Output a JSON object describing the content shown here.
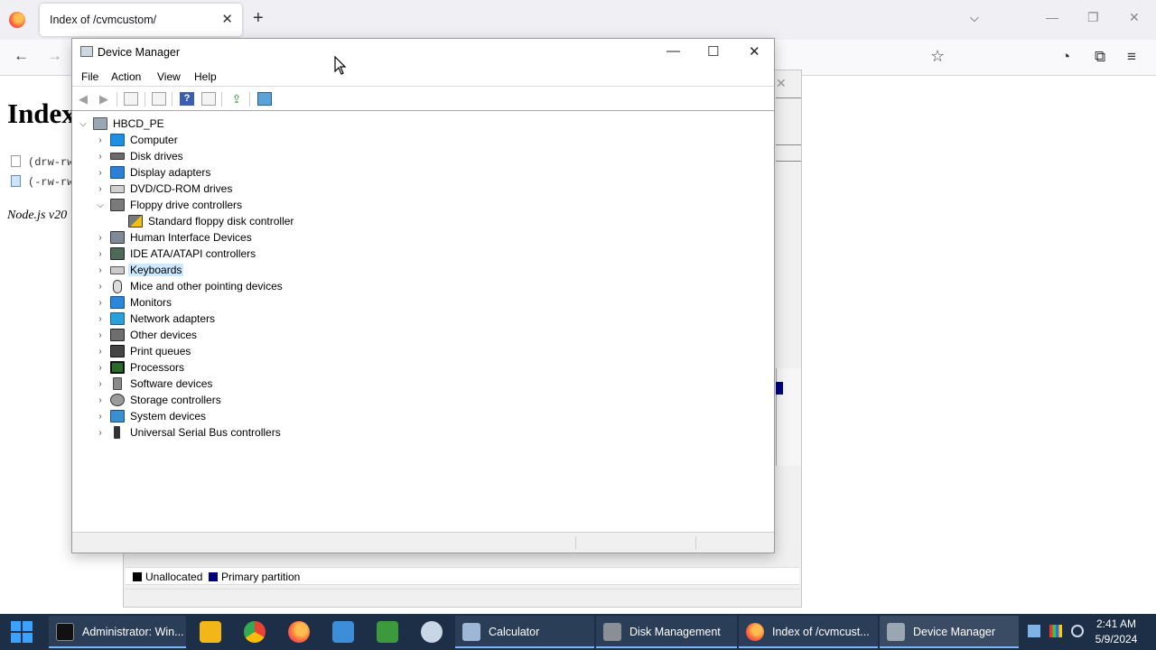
{
  "browser": {
    "tab_title": "Index of /cvmcustom/",
    "page_heading": "Index",
    "files": [
      "(drw-rw",
      "(-rw-rw"
    ],
    "footer": "Node.js v20"
  },
  "disk_management": {
    "legend": {
      "unallocated": "Unallocated",
      "primary": "Primary partition",
      "colors": {
        "unallocated": "#000000",
        "primary": "#000080"
      }
    }
  },
  "device_manager": {
    "title": "Device Manager",
    "menu": [
      "File",
      "Action",
      "View",
      "Help"
    ],
    "root": "HBCD_PE",
    "categories": [
      {
        "label": "Computer",
        "icon": "computer-icon"
      },
      {
        "label": "Disk drives",
        "icon": "disk-drive-icon"
      },
      {
        "label": "Display adapters",
        "icon": "display-adapter-icon"
      },
      {
        "label": "DVD/CD-ROM drives",
        "icon": "dvd-drive-icon"
      },
      {
        "label": "Floppy drive controllers",
        "icon": "floppy-controller-icon",
        "expanded": true,
        "children": [
          {
            "label": "Standard floppy disk controller",
            "icon": "floppy-warning-icon"
          }
        ]
      },
      {
        "label": "Human Interface Devices",
        "icon": "hid-icon"
      },
      {
        "label": "IDE ATA/ATAPI controllers",
        "icon": "ide-controller-icon"
      },
      {
        "label": "Keyboards",
        "icon": "keyboard-icon",
        "selected": true
      },
      {
        "label": "Mice and other pointing devices",
        "icon": "mouse-icon"
      },
      {
        "label": "Monitors",
        "icon": "monitor-icon"
      },
      {
        "label": "Network adapters",
        "icon": "network-adapter-icon"
      },
      {
        "label": "Other devices",
        "icon": "other-devices-icon"
      },
      {
        "label": "Print queues",
        "icon": "printer-icon"
      },
      {
        "label": "Processors",
        "icon": "processor-icon"
      },
      {
        "label": "Software devices",
        "icon": "software-device-icon"
      },
      {
        "label": "Storage controllers",
        "icon": "storage-controller-icon"
      },
      {
        "label": "System devices",
        "icon": "system-devices-icon"
      },
      {
        "label": "Universal Serial Bus controllers",
        "icon": "usb-icon"
      }
    ]
  },
  "taskbar": {
    "apps": [
      {
        "label": "Administrator: Win...",
        "icon": "terminal-icon",
        "state": "open"
      },
      {
        "label": "Calculator",
        "icon": "calculator-icon",
        "state": "open"
      },
      {
        "label": "Disk Management",
        "icon": "disk-management-icon",
        "state": "open"
      },
      {
        "label": "Index of /cvmcust...",
        "icon": "firefox-icon",
        "state": "open"
      },
      {
        "label": "Device Manager",
        "icon": "device-manager-icon",
        "state": "active"
      }
    ],
    "pinned": [
      "file-explorer-icon",
      "chrome-icon",
      "firefox-icon",
      "notepad-icon",
      "spreadsheet-icon",
      "tool-icon"
    ],
    "time": "2:41 AM",
    "date": "5/9/2024"
  }
}
